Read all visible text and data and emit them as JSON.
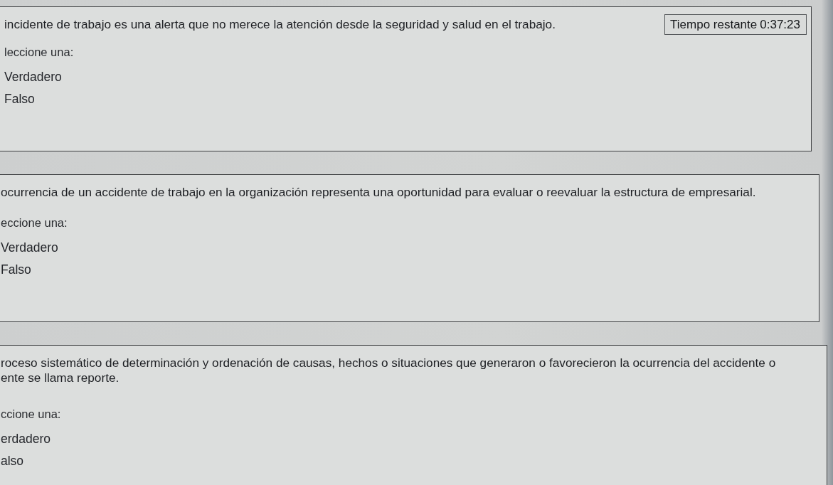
{
  "questions": [
    {
      "text_lines": [
        "incidente de trabajo es una alerta que no merece la atención desde la seguridad y salud en el trabajo."
      ],
      "timer": {
        "label": "Tiempo restante",
        "value": "0:37:23"
      },
      "prompt": "leccione una:",
      "options": [
        "Verdadero",
        "Falso"
      ]
    },
    {
      "text_lines": [
        "ocurrencia de un accidente de trabajo en la organización representa una oportunidad para evaluar o reevaluar la estructura de empresarial."
      ],
      "prompt": "eccione una:",
      "options": [
        "Verdadero",
        "Falso"
      ]
    },
    {
      "text_lines": [
        "roceso sistemático de determinación y ordenación de causas, hechos o situaciones que generaron o favorecieron la ocurrencia del accidente o",
        "ente se llama reporte."
      ],
      "prompt": "ccione una:",
      "options": [
        "erdadero",
        "also"
      ]
    }
  ]
}
